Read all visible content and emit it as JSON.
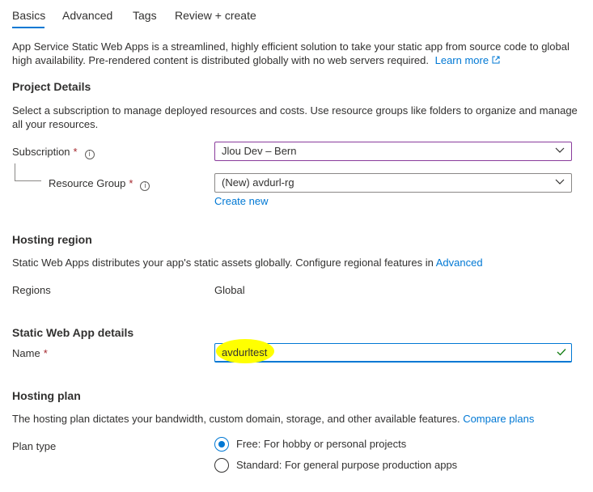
{
  "tabs": [
    {
      "label": "Basics",
      "active": true
    },
    {
      "label": "Advanced"
    },
    {
      "label": "Tags"
    },
    {
      "label": "Review + create"
    }
  ],
  "intro": {
    "line1": "App Service Static Web Apps is a streamlined, highly efficient solution to take your static app from source code to global",
    "line2": "high availability. Pre-rendered content is distributed globally with no web servers required.",
    "learn_more": "Learn more"
  },
  "project": {
    "heading": "Project Details",
    "desc_line1": "Select a subscription to manage deployed resources and costs. Use resource groups like folders to organize and manage",
    "desc_line2": "all your resources.",
    "subscription_label": "Subscription",
    "subscription_value": "Jlou Dev – Bern",
    "resource_group_label": "Resource Group",
    "resource_group_value": "(New) avdurl-rg",
    "create_new": "Create new",
    "required_mark": "*"
  },
  "hosting_region": {
    "heading": "Hosting region",
    "desc": "Static Web Apps distributes your app's static assets globally. Configure regional features in",
    "desc_link": "Advanced",
    "regions_label": "Regions",
    "regions_value": "Global"
  },
  "details": {
    "heading": "Static Web App details",
    "name_label": "Name",
    "name_value": "avdurltest"
  },
  "plan": {
    "heading": "Hosting plan",
    "desc": "The hosting plan dictates your bandwidth, custom domain, storage, and other available features.",
    "desc_link": "Compare plans",
    "plan_type_label": "Plan type",
    "options": [
      {
        "label": "Free: For hobby or personal projects",
        "selected": true
      },
      {
        "label": "Standard: For general purpose production apps",
        "selected": false
      }
    ]
  },
  "colors": {
    "accent": "#0078d4",
    "required": "#a4262c",
    "highlight": "#ffff00",
    "valid_check": "#107c10"
  }
}
